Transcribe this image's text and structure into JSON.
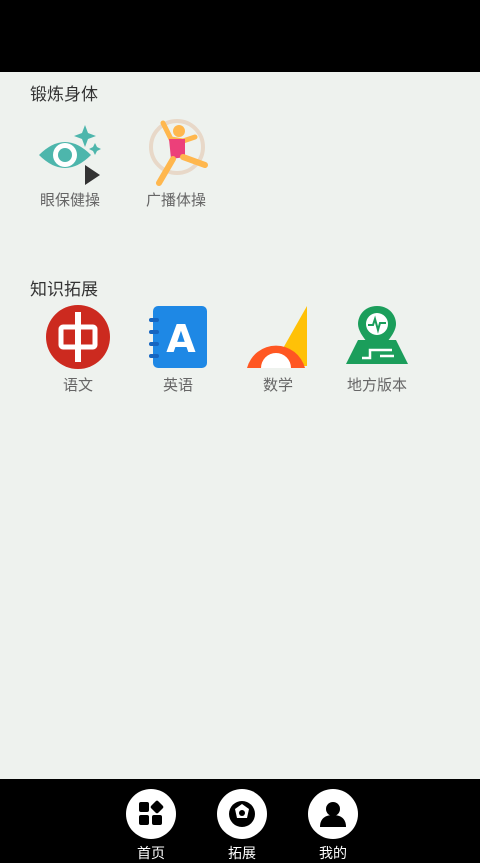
{
  "sections": {
    "exercise": {
      "title": "锻炼身体",
      "items": [
        {
          "label": "眼保健操",
          "icon": "eye-sparkle-icon"
        },
        {
          "label": "广播体操",
          "icon": "gymnast-icon"
        }
      ]
    },
    "knowledge": {
      "title": "知识拓展",
      "items": [
        {
          "label": "语文",
          "icon": "chinese-char-icon",
          "glyph": "中"
        },
        {
          "label": "英语",
          "icon": "english-notebook-icon",
          "glyph": "A"
        },
        {
          "label": "数学",
          "icon": "protractor-ruler-icon"
        },
        {
          "label": "地方版本",
          "icon": "map-pin-icon"
        }
      ]
    }
  },
  "bottom_nav": [
    {
      "label": "首页",
      "icon": "home-grid-icon"
    },
    {
      "label": "拓展",
      "icon": "ball-icon"
    },
    {
      "label": "我的",
      "icon": "user-icon"
    }
  ],
  "colors": {
    "content_bg": "#EEF2EE",
    "teal": "#4DB6AC",
    "red": "#D32F2F",
    "blue": "#1E88E5",
    "orange": "#FF7043",
    "green": "#1B9E5B"
  }
}
